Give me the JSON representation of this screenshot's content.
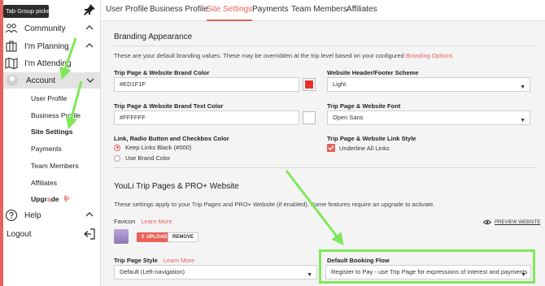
{
  "sidebar": {
    "tab_picker": "Tab Group picker",
    "items": {
      "community": "Community",
      "planning": "I'm Planning",
      "attending": "I'm Attending",
      "account": "Account",
      "help": "Help",
      "logout": "Logout"
    },
    "account_sub": [
      "User Profile",
      "Business Profile",
      "Site Settings",
      "Payments",
      "Team Members",
      "Affiliates"
    ],
    "upgrade_pre": "Upgr",
    "upgrade_g": "a",
    "upgrade_post": "de"
  },
  "tabs": [
    "User Profile",
    "Business Profile",
    "Site Settings",
    "Payments",
    "Team Members",
    "Affiliates"
  ],
  "active_tab": "Site Settings",
  "branding": {
    "title": "Branding Appearance",
    "desc": "These are your default branding values. These may be overridden at the trip level based on your configured ",
    "desc_link": "Branding Options",
    "brand_color_label": "Trip Page & Website Brand Color",
    "brand_color_value": "#ED1F1F",
    "brand_swatch": "#e8312f",
    "text_color_label": "Trip Page & Website Brand Text Color",
    "text_color_value": "#FFFFFF",
    "text_swatch": "#ffffff",
    "header_label": "Website Header/Footer Scheme",
    "header_value": "Light",
    "font_label": "Trip Page & Website Font",
    "font_value": "Open Sans",
    "link_style_label": "Link, Radio Button and Checkbox Color",
    "radio_keep": "Keep Links Black (#000)",
    "radio_brand": "Use Brand Color",
    "link_style2_label": "Trip Page & Website Link Style",
    "underline_label": "Underline All Links"
  },
  "youli": {
    "title": "YouLi Trip Pages & PRO+ Website",
    "desc": "These settings apply to your Trip Pages and PRO+ Website (if enabled). Some features require an upgrade to activate.",
    "favicon_label": "Favicon",
    "learn_more": "Learn More",
    "upload_btn": "UPLOAD",
    "remove_btn": "REMOVE",
    "preview": "PREVIEW WEBSITE",
    "trip_style_label": "Trip Page Style",
    "trip_style_value": "Default (Left-navigation)",
    "booking_label": "Default Booking Flow",
    "booking_value": "Register to Pay - use Trip Page for expressions of interest and payments"
  },
  "colors": {
    "accent": "#e8615a",
    "highlight": "#7fe85a"
  }
}
